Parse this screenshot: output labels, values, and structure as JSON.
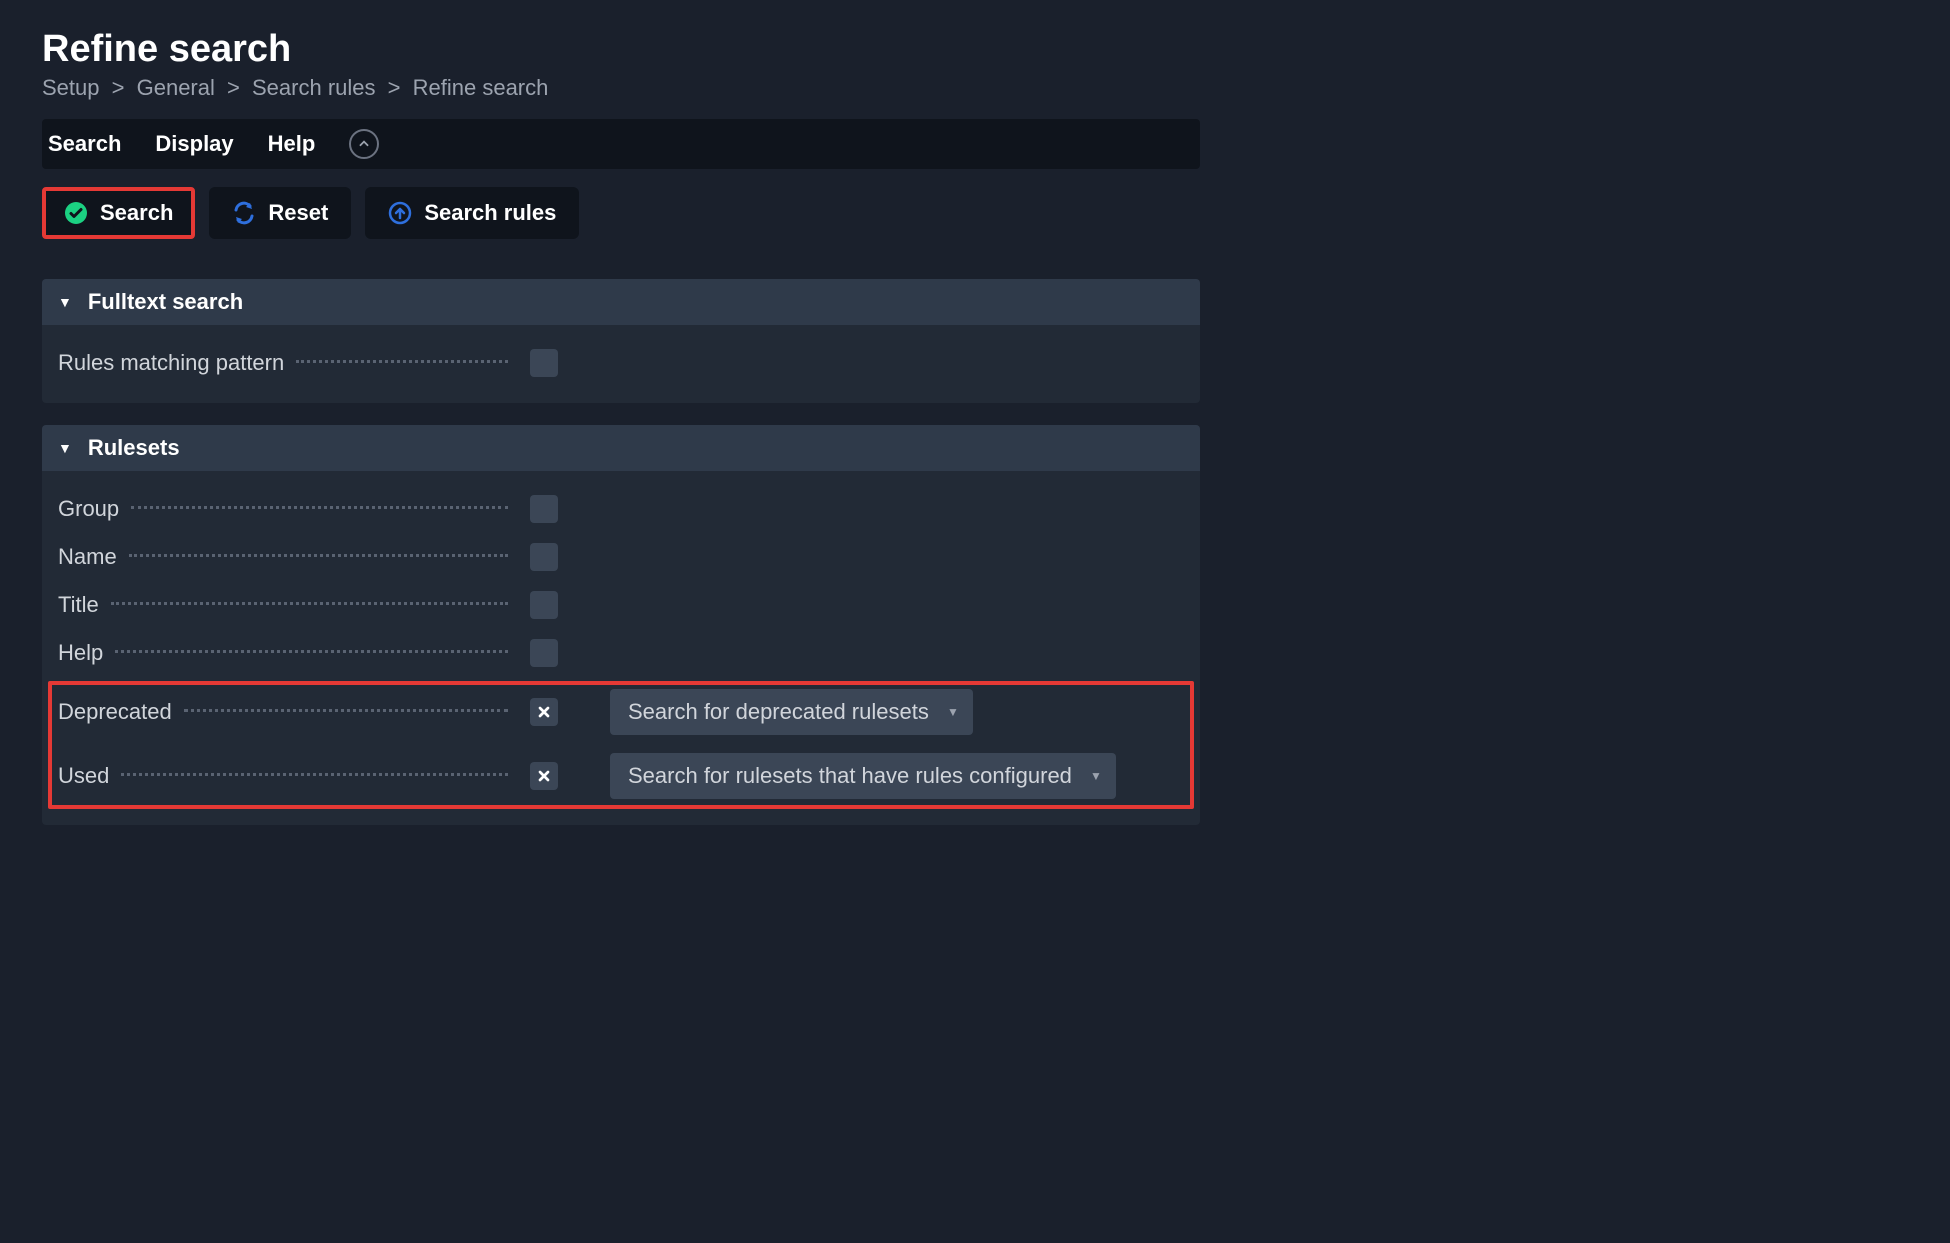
{
  "page": {
    "title": "Refine search"
  },
  "breadcrumb": {
    "items": [
      "Setup",
      "General",
      "Search rules",
      "Refine search"
    ]
  },
  "menubar": {
    "items": [
      "Search",
      "Display",
      "Help"
    ]
  },
  "actions": {
    "search": "Search",
    "reset": "Reset",
    "search_rules": "Search rules"
  },
  "panels": {
    "fulltext": {
      "title": "Fulltext search",
      "rows": {
        "pattern": {
          "label": "Rules matching pattern",
          "checked": false
        }
      }
    },
    "rulesets": {
      "title": "Rulesets",
      "rows": {
        "group": {
          "label": "Group",
          "checked": false
        },
        "name": {
          "label": "Name",
          "checked": false
        },
        "title": {
          "label": "Title",
          "checked": false
        },
        "help": {
          "label": "Help",
          "checked": false
        },
        "deprecated": {
          "label": "Deprecated",
          "checked": true,
          "value": "Search for deprecated rulesets"
        },
        "used": {
          "label": "Used",
          "checked": true,
          "value": "Search for rulesets that have rules configured"
        }
      }
    }
  },
  "colors": {
    "highlight": "#e53935",
    "accent_green": "#1bd182",
    "accent_blue": "#2e6fdd"
  }
}
